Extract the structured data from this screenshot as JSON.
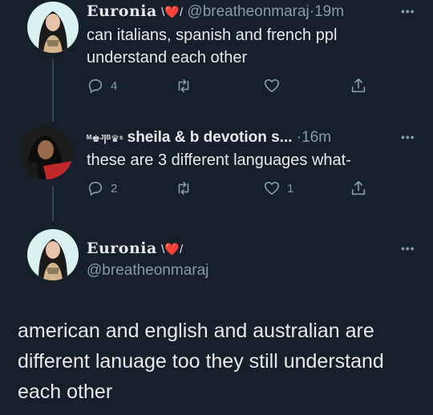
{
  "tweet1": {
    "display_name": "Euronia",
    "name_deco": "\\❤️/",
    "handle": "@breatheonmaraj",
    "separator": "·",
    "time": "19m",
    "text": "can italians, spanish and french ppl understand each other",
    "reply_count": "4",
    "retweet_count": "",
    "like_count": ""
  },
  "tweet2": {
    "display_name_prefix": "ᴹ♚ᴶ|ᴮ♛ˢ",
    "display_name": "sheila & b devotion s...",
    "separator": "·",
    "time": "16m",
    "text": "these are 3 different languages what-",
    "reply_count": "2",
    "retweet_count": "",
    "like_count": "1"
  },
  "main_tweet": {
    "display_name": "Euronia",
    "name_deco": "\\❤️/",
    "handle": "@breatheonmaraj",
    "text": "american and english and australian are different lanuage too they still understand each other"
  },
  "ui": {
    "more_label": "•••"
  },
  "colors": {
    "background": "#15202b",
    "text": "#e7e9ea",
    "muted": "#8b98a5",
    "thread_line": "#38444d"
  },
  "icons": [
    "reply-icon",
    "retweet-icon",
    "like-icon",
    "share-icon",
    "more-icon"
  ]
}
